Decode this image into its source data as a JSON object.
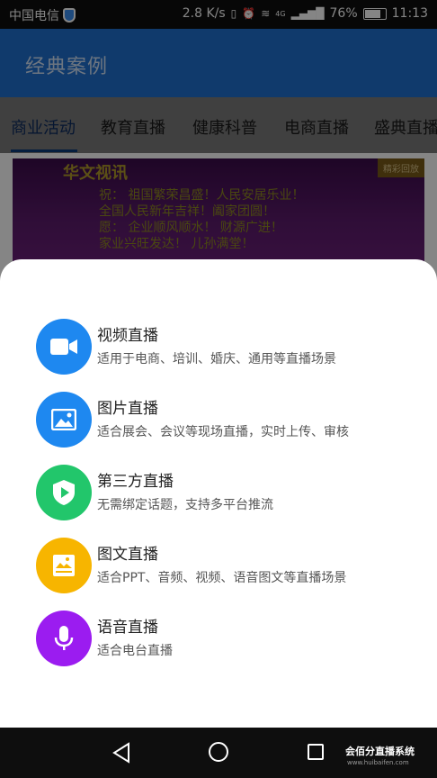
{
  "status_bar": {
    "carrier": "中国电信",
    "speed": "2.8 K/s",
    "network": "4G",
    "battery": "76%",
    "time": "11:13"
  },
  "app_bar": {
    "title": "经典案例"
  },
  "tabs": [
    {
      "label": "商业活动",
      "active": true
    },
    {
      "label": "教育直播"
    },
    {
      "label": "健康科普"
    },
    {
      "label": "电商直播"
    },
    {
      "label": "盛典直播"
    }
  ],
  "banner": {
    "title": "华文视讯",
    "badge": "精彩回放",
    "lines": [
      "祝：  祖国繁荣昌盛！人民安居乐业！",
      "全国人民新年吉祥！阖家团圆！",
      "愿：  企业顺风顺水！  财源广进！",
      "家业兴旺发达！  儿孙满堂！"
    ]
  },
  "sheet": {
    "items": [
      {
        "title": "视频直播",
        "desc": "适用于电商、培训、婚庆、通用等直播场景",
        "icon": "video-camera-icon",
        "color": "#1e88f0"
      },
      {
        "title": "图片直播",
        "desc": "适合展会、会议等现场直播，实时上传、审核",
        "icon": "image-icon",
        "color": "#1e88f0"
      },
      {
        "title": "第三方直播",
        "desc": "无需绑定话题，支持多平台推流",
        "icon": "shield-play-icon",
        "color": "#22c66b"
      },
      {
        "title": "图文直播",
        "desc": "适合PPT、音频、视频、语音图文等直播场景",
        "icon": "picture-text-icon",
        "color": "#f7b500"
      },
      {
        "title": "语音直播",
        "desc": "适合电台直播",
        "icon": "microphone-icon",
        "color": "#9b1cf0"
      }
    ]
  },
  "watermark": {
    "title": "会佰分直播系统",
    "url": "www.huibaifen.com"
  }
}
